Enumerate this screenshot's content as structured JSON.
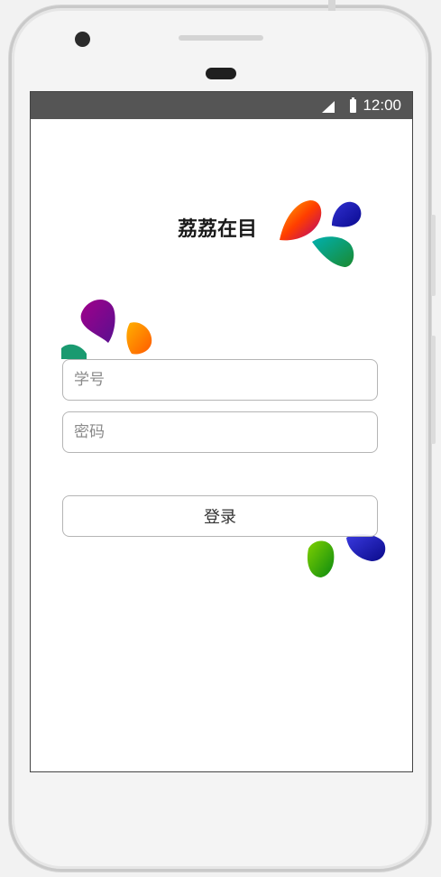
{
  "status_bar": {
    "time": "12:00",
    "signal_icon": "cell-signal-icon",
    "battery_icon": "battery-icon",
    "background": "#555555"
  },
  "app": {
    "title": "荔荔在目"
  },
  "login_form": {
    "student_id_placeholder": "学号",
    "student_id_value": "",
    "password_placeholder": "密码",
    "password_value": "",
    "login_label": "登录"
  },
  "decorations": [
    "colorful-petal-logo",
    "colorful-petal-cluster-left",
    "colorful-petal-cluster-bottom-right"
  ]
}
